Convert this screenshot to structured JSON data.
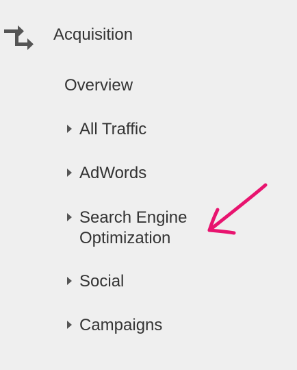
{
  "section": {
    "title": "Acquisition",
    "icon": "swap-arrows-icon"
  },
  "menu": {
    "overview_label": "Overview",
    "items": [
      {
        "label": "All Traffic",
        "icon": "caret-right-icon"
      },
      {
        "label": "AdWords",
        "icon": "caret-right-icon"
      },
      {
        "label_line1": "Search Engine",
        "label_line2": "Optimization",
        "icon": "caret-right-icon"
      },
      {
        "label": "Social",
        "icon": "caret-right-icon"
      },
      {
        "label": "Campaigns",
        "icon": "caret-right-icon"
      }
    ]
  },
  "annotation": {
    "icon": "pink-arrow-annotation",
    "color": "#e8146f"
  },
  "colors": {
    "background": "#efefef",
    "text": "#333333",
    "icon": "#555555"
  }
}
